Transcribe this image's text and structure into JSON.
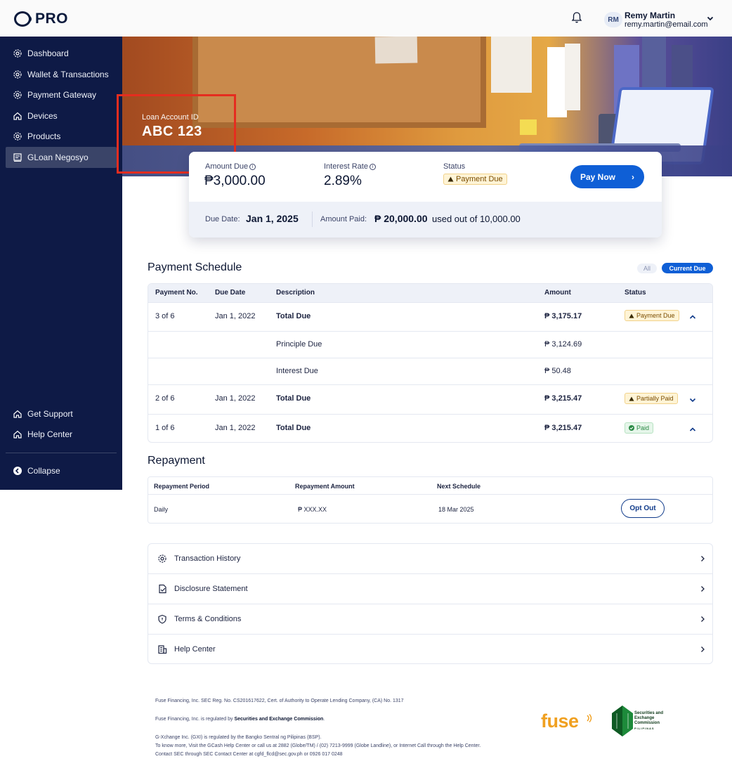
{
  "header": {
    "logo_text": "PRO",
    "user_initials": "RM",
    "user_name": "Remy Martin",
    "user_email": "remy.martin@email.com"
  },
  "sidebar": {
    "items": [
      {
        "label": "Dashboard",
        "icon": "gear-icon"
      },
      {
        "label": "Wallet & Transactions",
        "icon": "gear-icon"
      },
      {
        "label": "Payment Gateway",
        "icon": "gear-icon"
      },
      {
        "label": "Devices",
        "icon": "home-icon"
      },
      {
        "label": "Products",
        "icon": "gear-icon"
      },
      {
        "label": "GLoan Negosyo",
        "icon": "store-icon",
        "active": true
      }
    ],
    "bottom_items": [
      {
        "label": "Get Support",
        "icon": "home-icon"
      },
      {
        "label": "Help Center",
        "icon": "home-icon"
      }
    ],
    "collapse_label": "Collapse"
  },
  "hero": {
    "label": "Loan Account ID",
    "account_id": "ABC 123"
  },
  "summary": {
    "amount_due_label": "Amount Due",
    "amount_due": "₱3,000.00",
    "interest_rate_label": "Interest Rate",
    "interest_rate": "2.89%",
    "status_label": "Status",
    "status": "Payment Due",
    "pay_now": "Pay Now",
    "due_date_label": "Due Date:",
    "due_date": "Jan 1, 2025",
    "amount_paid_label": "Amount Paid:",
    "amount_paid": "₱ 20,000.00",
    "amount_paid_suffix": "used out of 10,000.00"
  },
  "schedule": {
    "title": "Payment Schedule",
    "filter_all": "All",
    "filter_current": "Current Due",
    "columns": [
      "Payment No.",
      "Due Date",
      "Description",
      "Amount",
      "Status"
    ],
    "rows": [
      {
        "no": "3 of 6",
        "date": "Jan 1, 2022",
        "desc": "Total Due",
        "amount": "₱ 3,175.17",
        "status": "Payment Due",
        "status_type": "due",
        "expanded": true
      },
      {
        "no": "",
        "date": "",
        "desc": "Principle Due",
        "amount": "₱ 3,124.69",
        "status": "",
        "status_type": ""
      },
      {
        "no": "",
        "date": "",
        "desc": "Interest Due",
        "amount": "₱ 50.48",
        "status": "",
        "status_type": ""
      },
      {
        "no": "2 of 6",
        "date": "Jan 1, 2022",
        "desc": "Total Due",
        "amount": "₱ 3,215.47",
        "status": "Partially Paid",
        "status_type": "partial",
        "expanded": false
      },
      {
        "no": "1 of 6",
        "date": "Jan 1, 2022",
        "desc": "Total Due",
        "amount": "₱ 3,215.47",
        "status": "Paid",
        "status_type": "paid",
        "expanded": true
      }
    ]
  },
  "repayment": {
    "title": "Repayment",
    "columns": [
      "Repayment Period",
      "Repayment Amount",
      "Next Schedule"
    ],
    "period": "Daily",
    "amount": "₱ XXX.XX",
    "next_schedule": "18 Mar 2025",
    "opt_out": "Opt Out"
  },
  "links": [
    {
      "label": "Transaction History",
      "icon": "gear-icon"
    },
    {
      "label": "Disclosure Statement",
      "icon": "document-icon"
    },
    {
      "label": "Terms & Conditions",
      "icon": "shield-icon"
    },
    {
      "label": "Help Center",
      "icon": "building-icon"
    }
  ],
  "footer": {
    "line1": "Fuse Financing, Inc. SEC Reg. No. CS201617622,  Cert. of Authority to Operate Lending Company, (CA) No. 1317",
    "line2_prefix": "Fuse Financing, Inc. is regulated by ",
    "line2_link": "Securities and Exchange Commission",
    "line2_suffix": ".",
    "line3": "G-Xchange Inc. (GXI) is regulated by the Bangko Sentral ng Pilipinas (BSP).",
    "line4": "To know more, Visit the GCash Help Center or call us at 2882 (Globe/TM) / (02) 7213-9999 (Globe Landline), or Internet Call through the Help Center.",
    "line5": "Contact SEC through SEC Contact Center at cgfd_flcd@sec.gov.ph or 0926 017 0248",
    "fuse_logo": "fuse",
    "sec_logo_text": [
      "Securities and",
      "Exchange",
      "Commission",
      "PILIPINAS"
    ]
  },
  "colors": {
    "sidebar_bg": "#0e1a46",
    "primary": "#0f5fd6",
    "highlight_box": "#e52d1f",
    "fuse_orange": "#f0a020"
  }
}
